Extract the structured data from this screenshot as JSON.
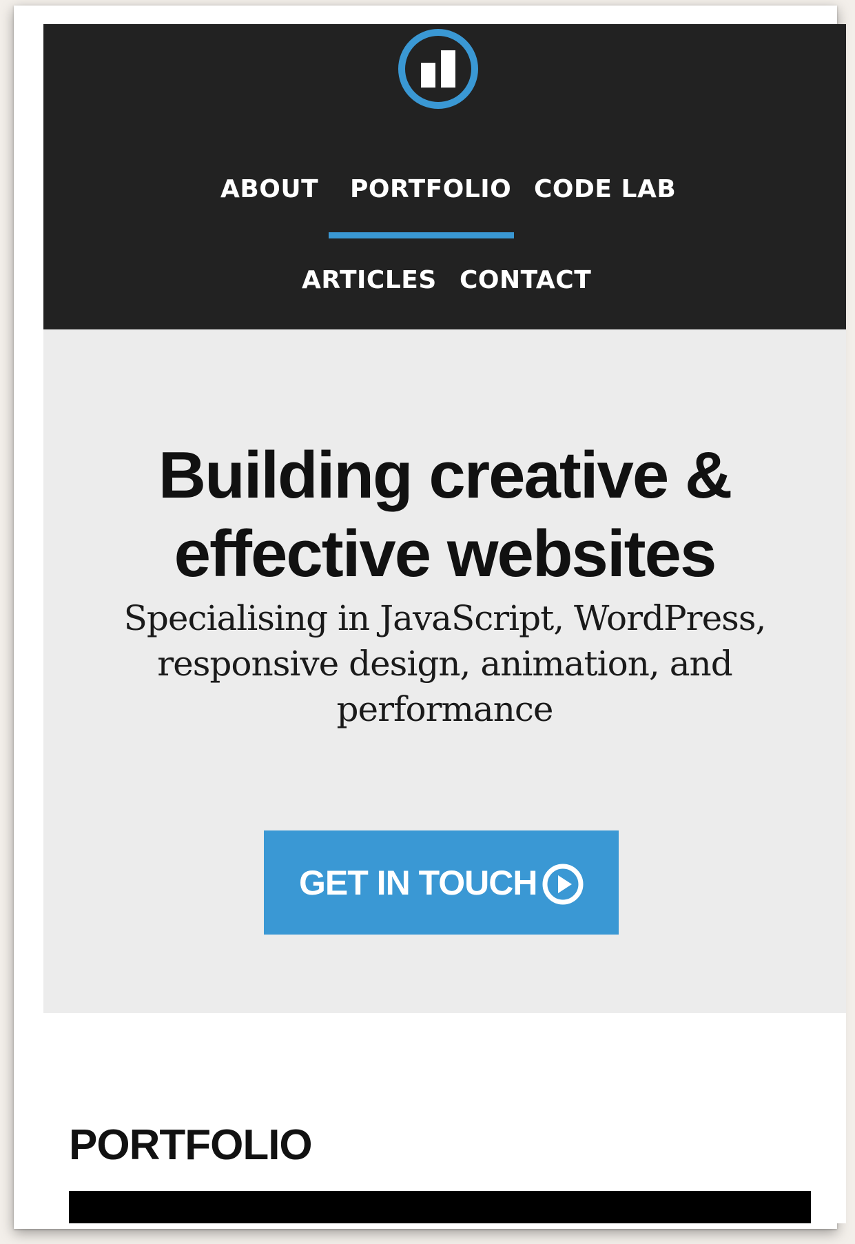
{
  "nav": {
    "items": [
      {
        "label": "ABOUT"
      },
      {
        "label": "PORTFOLIO"
      },
      {
        "label": "CODE LAB"
      },
      {
        "label": "ARTICLES"
      },
      {
        "label": "CONTACT"
      }
    ],
    "active": "PORTFOLIO"
  },
  "logo": {
    "icon": "bar-chart-logo-icon",
    "ring_color": "#3a98d4",
    "bar_color": "#ffffff"
  },
  "hero": {
    "title": "Building creative & effective websites",
    "subtitle": "Specialising in JavaScript, WordPress, responsive design, animation, and performance",
    "cta_label": "GET IN TOUCH",
    "cta_icon": "play-circle-icon"
  },
  "portfolio": {
    "title": "PORTFOLIO"
  },
  "colors": {
    "header_bg": "#222222",
    "accent": "#3a98d4",
    "hero_bg": "#ececec",
    "text": "#111111"
  }
}
